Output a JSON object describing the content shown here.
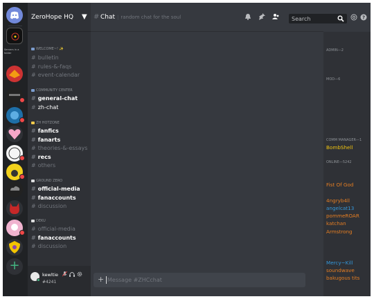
{
  "server": {
    "name": "ZeroHope HQ",
    "folder_label": "Servers in a folder",
    "rail": [
      {
        "name": "discord-home",
        "color": "#7289da",
        "text": "",
        "badge": ""
      },
      {
        "name": "server-zerohope",
        "color": "#111111",
        "text": "",
        "badge": ""
      },
      {
        "name": "server-2",
        "color": "#cc3333",
        "text": "",
        "badge": ""
      },
      {
        "name": "server-3",
        "color": "#222222",
        "text": "",
        "badge": "1"
      },
      {
        "name": "server-4",
        "color": "#1e6fa8",
        "text": "",
        "badge": "2"
      },
      {
        "name": "server-5",
        "color": "#f6a6c8",
        "text": "",
        "badge": ""
      },
      {
        "name": "server-6",
        "color": "#f5f5f5",
        "text": "",
        "badge": "5"
      },
      {
        "name": "server-7",
        "color": "#f3d21c",
        "text": "",
        "badge": "3"
      },
      {
        "name": "server-8",
        "color": "#222222",
        "text": "",
        "badge": ""
      },
      {
        "name": "server-9",
        "color": "#c62828",
        "text": "",
        "badge": ""
      },
      {
        "name": "server-10",
        "color": "#f0b3cf",
        "text": "",
        "badge": "2"
      },
      {
        "name": "server-11",
        "color": "#f2c300",
        "text": "",
        "badge": ""
      }
    ],
    "add_server": "+"
  },
  "categories": [
    {
      "label": "welcome~! ✨",
      "icon_color": "#7b9ccd",
      "channels": [
        {
          "name": "bulletin",
          "state": "muted"
        },
        {
          "name": "rules-&-faqs",
          "state": "muted"
        },
        {
          "name": "event-calendar",
          "state": "muted"
        }
      ]
    },
    {
      "label": "community center",
      "icon_color": "#7b9ccd",
      "channels": [
        {
          "name": "general-chat",
          "state": "unread"
        },
        {
          "name": "zh-chat",
          "state": "active"
        }
      ]
    },
    {
      "label": "ZH hotzone",
      "icon_color": "#f2c94c",
      "channels": [
        {
          "name": "fanfics",
          "state": "unread"
        },
        {
          "name": "fanarts",
          "state": "unread"
        },
        {
          "name": "theories-&-essays",
          "state": "muted"
        },
        {
          "name": "recs",
          "state": "unread"
        },
        {
          "name": "others",
          "state": "muted"
        }
      ]
    },
    {
      "label": "ground zero",
      "icon_color": "#dcddde",
      "channels": [
        {
          "name": "official-media",
          "state": "unread"
        },
        {
          "name": "fanaccounts",
          "state": "unread"
        },
        {
          "name": "discussion",
          "state": "muted"
        }
      ]
    },
    {
      "label": "deku",
      "icon_color": "#dcddde",
      "channels": [
        {
          "name": "official-media",
          "state": "muted"
        },
        {
          "name": "fanaccounts",
          "state": "unread"
        },
        {
          "name": "discussion",
          "state": "muted"
        }
      ]
    }
  ],
  "user": {
    "name": "kewltie",
    "discriminator": "#4241"
  },
  "chat": {
    "channel_hash": "#",
    "channel_name": "Chat",
    "topic": "random chat for the soul",
    "composer_placeholder": "Message #ZHCchat",
    "composer_plus": "+"
  },
  "search": {
    "placeholder": "Search"
  },
  "members": {
    "groups": [
      {
        "label": "ADMIN—2",
        "members": [
          {
            "name": "",
            "color": "#7b3bb5"
          },
          {
            "name": "",
            "color": "#7b3bb5"
          }
        ]
      },
      {
        "label": "MOD—6",
        "members": [
          {
            "name": "",
            "color": "#a8324a"
          },
          {
            "name": "",
            "color": "#a8324a"
          },
          {
            "name": "",
            "color": "#a8324a"
          },
          {
            "name": "",
            "color": "#a8324a"
          },
          {
            "name": "",
            "color": "#a8324a"
          },
          {
            "name": "",
            "color": "#a8324a"
          }
        ]
      },
      {
        "label": "COMM MANAGER—1",
        "members": [
          {
            "name": "BombShell",
            "color": "#f1c40f"
          }
        ]
      },
      {
        "label": "ONLINE—5242",
        "members": [
          {
            "name": "",
            "color": "#2f7d32"
          },
          {
            "name": "",
            "color": "#2f7d32"
          },
          {
            "name": "Fist Of God",
            "color": "#e67e22"
          },
          {
            "name": "",
            "color": "#2f7d32"
          },
          {
            "name": "4ngryb4ll",
            "color": "#e67e22"
          },
          {
            "name": "angelcat13",
            "color": "#3498db"
          },
          {
            "name": "pommeROAR",
            "color": "#e67e22"
          },
          {
            "name": "katchan",
            "color": "#e67e22"
          },
          {
            "name": "Armstrong",
            "color": "#e67e22"
          },
          {
            "name": "",
            "color": "#2f7d32"
          },
          {
            "name": "",
            "color": "#2f7d32"
          },
          {
            "name": "",
            "color": "#2f7d32"
          },
          {
            "name": "Mercy~Kill",
            "color": "#3498db"
          },
          {
            "name": "soundwave",
            "color": "#e67e22"
          },
          {
            "name": "bakugous tits",
            "color": "#e67e22"
          }
        ]
      }
    ]
  },
  "colors": {
    "rail": "#202225",
    "sidebar": "#2f3136",
    "chat": "#36393f",
    "online": "#43b581"
  }
}
